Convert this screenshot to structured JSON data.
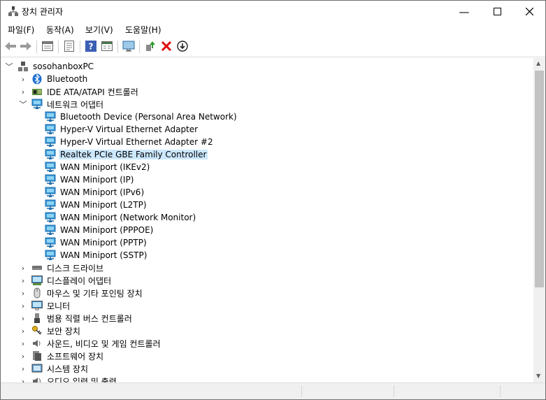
{
  "window": {
    "title": "장치 관리자"
  },
  "menu": [
    "파일(F)",
    "동작(A)",
    "보기(V)",
    "도움말(H)"
  ],
  "toolbar_icons": [
    "back-icon",
    "forward-icon",
    "properties-icon",
    "list-icon",
    "help-icon",
    "details-icon",
    "monitor-icon",
    "update-driver-icon",
    "uninstall-icon",
    "scan-icon"
  ],
  "tree": {
    "root": "sosohanboxPC",
    "items": [
      {
        "label": "Bluetooth",
        "icon": "bluetooth-icon",
        "expanded": false
      },
      {
        "label": "IDE ATA/ATAPI 컨트롤러",
        "icon": "ide-controller-icon",
        "expanded": false
      },
      {
        "label": "네트워크 어댑터",
        "icon": "network-adapter-icon",
        "expanded": true,
        "children": [
          "Bluetooth Device (Personal Area Network)",
          "Hyper-V Virtual Ethernet Adapter",
          "Hyper-V Virtual Ethernet Adapter #2",
          "Realtek PCIe GBE Family Controller",
          "WAN Miniport (IKEv2)",
          "WAN Miniport (IP)",
          "WAN Miniport (IPv6)",
          "WAN Miniport (L2TP)",
          "WAN Miniport (Network Monitor)",
          "WAN Miniport (PPPOE)",
          "WAN Miniport (PPTP)",
          "WAN Miniport (SSTP)"
        ],
        "selected_child": "Realtek PCIe GBE Family Controller"
      },
      {
        "label": "디스크 드라이브",
        "icon": "disk-drive-icon",
        "expanded": false
      },
      {
        "label": "디스플레이 어댑터",
        "icon": "display-adapter-icon",
        "expanded": false
      },
      {
        "label": "마우스 및 기타 포인팅 장치",
        "icon": "mouse-icon",
        "expanded": false
      },
      {
        "label": "모니터",
        "icon": "monitor-icon",
        "expanded": false
      },
      {
        "label": "범용 직렬 버스 컨트롤러",
        "icon": "usb-icon",
        "expanded": false
      },
      {
        "label": "보안 장치",
        "icon": "security-device-icon",
        "expanded": false
      },
      {
        "label": "사운드, 비디오 및 게임 컨트롤러",
        "icon": "sound-icon",
        "expanded": false
      },
      {
        "label": "소프트웨어 장치",
        "icon": "software-device-icon",
        "expanded": false
      },
      {
        "label": "시스템 장치",
        "icon": "system-device-icon",
        "expanded": false
      },
      {
        "label": "오디오 입력 및 출력",
        "icon": "audio-io-icon",
        "expanded": false
      }
    ]
  },
  "colors": {
    "selection": "#cce8ff",
    "network": "#1c86d1"
  }
}
